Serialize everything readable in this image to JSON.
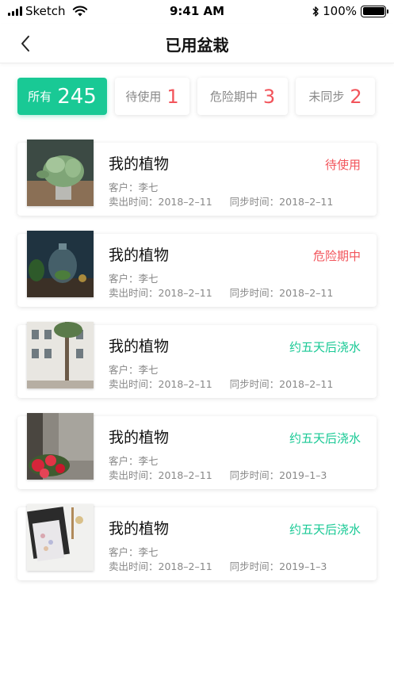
{
  "status_bar": {
    "carrier": "Sketch",
    "time": "9:41 AM",
    "battery": "100%"
  },
  "nav": {
    "title": "已用盆栽",
    "back_icon": "chevron-left-icon"
  },
  "filters": [
    {
      "label": "所有",
      "count": "245",
      "active": true
    },
    {
      "label": "待使用",
      "count": "1",
      "active": false
    },
    {
      "label": "危险期中",
      "count": "3",
      "active": false
    },
    {
      "label": "未同步",
      "count": "2",
      "active": false
    }
  ],
  "colors": {
    "accent": "#19c995",
    "warning": "#f2545b",
    "muted_text": "#888888"
  },
  "plants": [
    {
      "title": "我的植物",
      "status": "待使用",
      "status_type": "warn",
      "customer": "客户：李七",
      "sold": "卖出时间：2018–2–11",
      "synced": "同步时间：2018–2–11",
      "image": "potted-herb-photo"
    },
    {
      "title": "我的植物",
      "status": "危险期中",
      "status_type": "warn",
      "customer": "客户：李七",
      "sold": "卖出时间：2018–2–11",
      "synced": "同步时间：2018–2–11",
      "image": "glass-terrarium-photo"
    },
    {
      "title": "我的植物",
      "status": "约五天后浇水",
      "status_type": "ok",
      "customer": "客户：李七",
      "sold": "卖出时间：2018–2–11",
      "synced": "同步时间：2018–2–11",
      "image": "street-tree-building-photo"
    },
    {
      "title": "我的植物",
      "status": "约五天后浇水",
      "status_type": "ok",
      "customer": "客户：李七",
      "sold": "卖出时间：2018–2–11",
      "synced": "同步时间：2019–1–3",
      "image": "red-roses-photo"
    },
    {
      "title": "我的植物",
      "status": "约五天后浇水",
      "status_type": "ok",
      "customer": "客户：李七",
      "sold": "卖出时间：2018–2–11",
      "synced": "同步时间：2019–1–3",
      "image": "desk-notebook-photo"
    }
  ]
}
